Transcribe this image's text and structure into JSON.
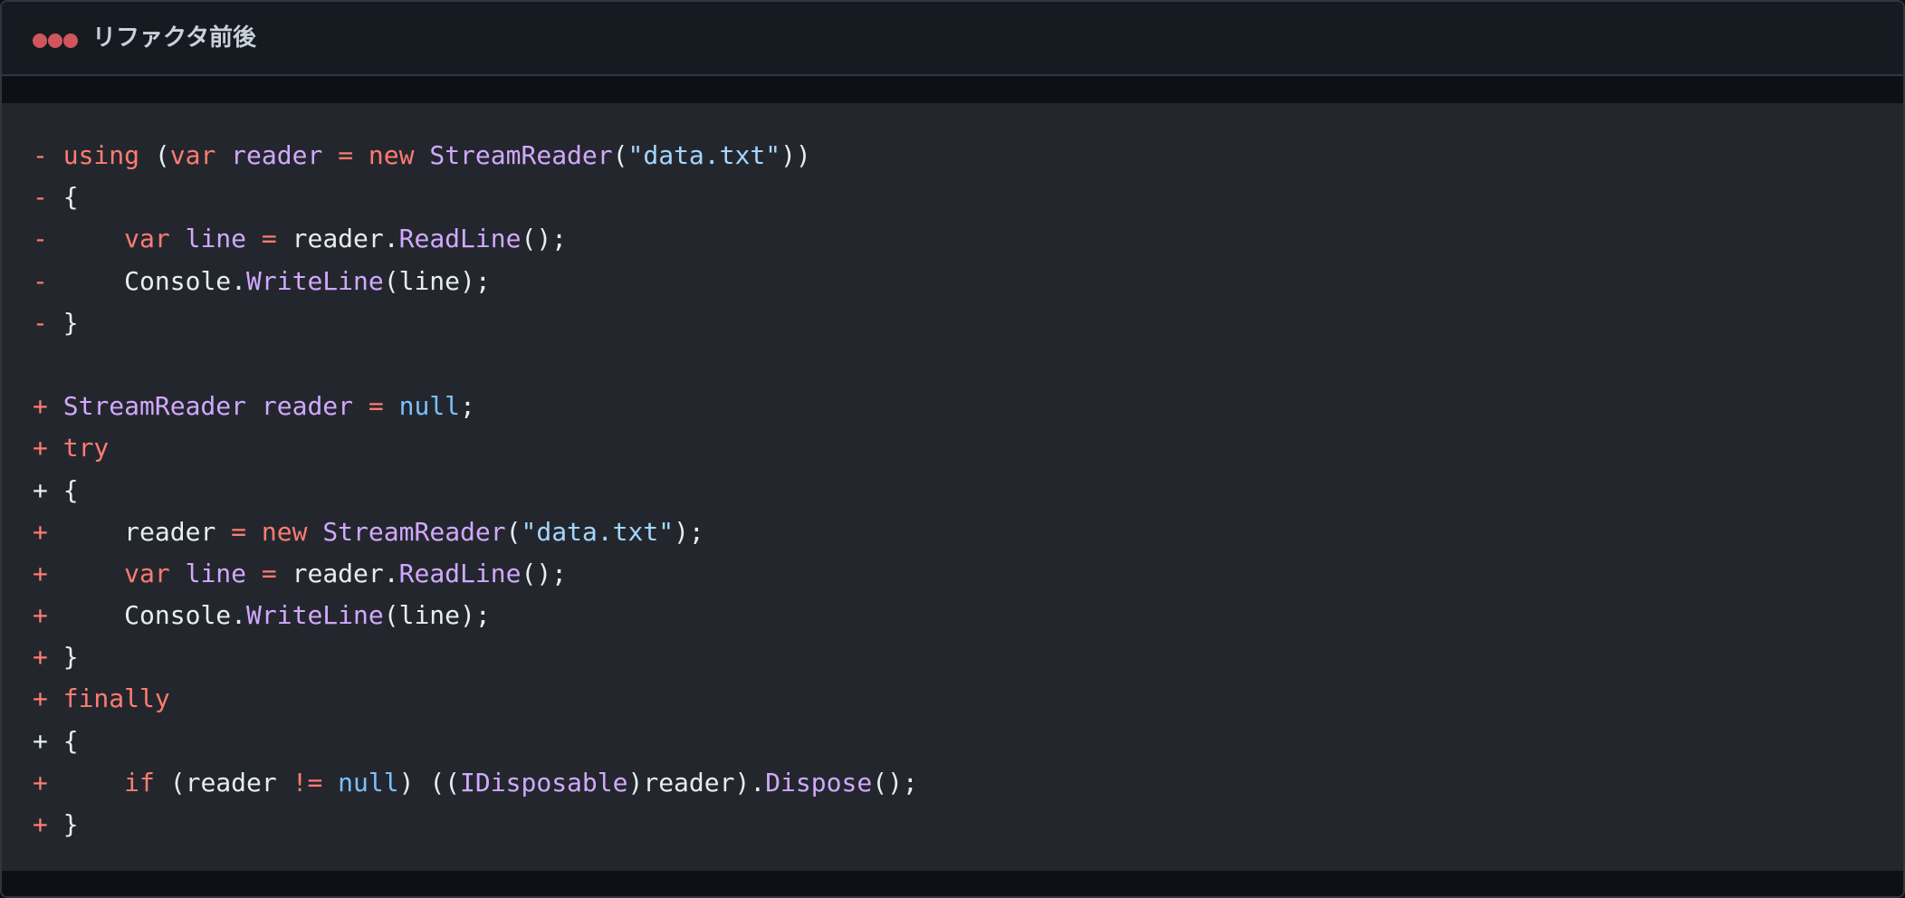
{
  "window": {
    "title": "リファクタ前後"
  },
  "colors": {
    "window_dot": "#d1555d",
    "diff_marker": "#ff7b72",
    "keyword": "#ff7b72",
    "type_identifier": "#d2a8ff",
    "method": "#d2a8ff",
    "string": "#a5d6ff",
    "null_literal": "#79c0ff",
    "plain": "#e6edf3"
  },
  "code_lines": [
    {
      "tokens": [
        {
          "t": "- ",
          "k": "marker"
        },
        {
          "t": "using",
          "k": "keyword"
        },
        {
          "t": " (",
          "k": "plain"
        },
        {
          "t": "var",
          "k": "keyword"
        },
        {
          "t": " ",
          "k": "plain"
        },
        {
          "t": "reader",
          "k": "type"
        },
        {
          "t": " ",
          "k": "plain"
        },
        {
          "t": "=",
          "k": "keyword"
        },
        {
          "t": " ",
          "k": "plain"
        },
        {
          "t": "new",
          "k": "keyword"
        },
        {
          "t": " ",
          "k": "plain"
        },
        {
          "t": "StreamReader",
          "k": "type"
        },
        {
          "t": "(",
          "k": "plain"
        },
        {
          "t": "\"data.txt\"",
          "k": "string"
        },
        {
          "t": "))",
          "k": "plain"
        }
      ]
    },
    {
      "tokens": [
        {
          "t": "- ",
          "k": "marker"
        },
        {
          "t": "{",
          "k": "plain"
        }
      ]
    },
    {
      "tokens": [
        {
          "t": "-     ",
          "k": "marker"
        },
        {
          "t": "var",
          "k": "keyword"
        },
        {
          "t": " ",
          "k": "plain"
        },
        {
          "t": "line",
          "k": "type"
        },
        {
          "t": " ",
          "k": "plain"
        },
        {
          "t": "=",
          "k": "keyword"
        },
        {
          "t": " reader.",
          "k": "plain"
        },
        {
          "t": "ReadLine",
          "k": "method"
        },
        {
          "t": "();",
          "k": "plain"
        }
      ]
    },
    {
      "tokens": [
        {
          "t": "-     ",
          "k": "marker"
        },
        {
          "t": "Console.",
          "k": "plain"
        },
        {
          "t": "WriteLine",
          "k": "method"
        },
        {
          "t": "(line);",
          "k": "plain"
        }
      ]
    },
    {
      "tokens": [
        {
          "t": "- ",
          "k": "marker"
        },
        {
          "t": "}",
          "k": "plain"
        }
      ]
    },
    {
      "tokens": []
    },
    {
      "tokens": [
        {
          "t": "+ ",
          "k": "marker"
        },
        {
          "t": "StreamReader",
          "k": "type"
        },
        {
          "t": " ",
          "k": "plain"
        },
        {
          "t": "reader",
          "k": "type"
        },
        {
          "t": " ",
          "k": "plain"
        },
        {
          "t": "=",
          "k": "keyword"
        },
        {
          "t": " ",
          "k": "plain"
        },
        {
          "t": "null",
          "k": "null"
        },
        {
          "t": ";",
          "k": "plain"
        }
      ]
    },
    {
      "tokens": [
        {
          "t": "+ ",
          "k": "marker"
        },
        {
          "t": "try",
          "k": "keyword"
        }
      ]
    },
    {
      "tokens": [
        {
          "t": "+ {",
          "k": "plain"
        }
      ]
    },
    {
      "tokens": [
        {
          "t": "+     ",
          "k": "marker"
        },
        {
          "t": "reader ",
          "k": "plain"
        },
        {
          "t": "=",
          "k": "keyword"
        },
        {
          "t": " ",
          "k": "plain"
        },
        {
          "t": "new",
          "k": "keyword"
        },
        {
          "t": " ",
          "k": "plain"
        },
        {
          "t": "StreamReader",
          "k": "type"
        },
        {
          "t": "(",
          "k": "plain"
        },
        {
          "t": "\"data.txt\"",
          "k": "string"
        },
        {
          "t": ");",
          "k": "plain"
        }
      ]
    },
    {
      "tokens": [
        {
          "t": "+     ",
          "k": "marker"
        },
        {
          "t": "var",
          "k": "keyword"
        },
        {
          "t": " ",
          "k": "plain"
        },
        {
          "t": "line",
          "k": "type"
        },
        {
          "t": " ",
          "k": "plain"
        },
        {
          "t": "=",
          "k": "keyword"
        },
        {
          "t": " reader.",
          "k": "plain"
        },
        {
          "t": "ReadLine",
          "k": "method"
        },
        {
          "t": "();",
          "k": "plain"
        }
      ]
    },
    {
      "tokens": [
        {
          "t": "+     ",
          "k": "marker"
        },
        {
          "t": "Console.",
          "k": "plain"
        },
        {
          "t": "WriteLine",
          "k": "method"
        },
        {
          "t": "(line);",
          "k": "plain"
        }
      ]
    },
    {
      "tokens": [
        {
          "t": "+ ",
          "k": "marker"
        },
        {
          "t": "}",
          "k": "plain"
        }
      ]
    },
    {
      "tokens": [
        {
          "t": "+ ",
          "k": "marker"
        },
        {
          "t": "finally",
          "k": "keyword"
        }
      ]
    },
    {
      "tokens": [
        {
          "t": "+ {",
          "k": "plain"
        }
      ]
    },
    {
      "tokens": [
        {
          "t": "+     ",
          "k": "marker"
        },
        {
          "t": "if",
          "k": "keyword"
        },
        {
          "t": " (reader ",
          "k": "plain"
        },
        {
          "t": "!=",
          "k": "keyword"
        },
        {
          "t": " ",
          "k": "plain"
        },
        {
          "t": "null",
          "k": "null"
        },
        {
          "t": ") ((",
          "k": "plain"
        },
        {
          "t": "IDisposable",
          "k": "type"
        },
        {
          "t": ")reader).",
          "k": "plain"
        },
        {
          "t": "Dispose",
          "k": "method"
        },
        {
          "t": "();",
          "k": "plain"
        }
      ]
    },
    {
      "tokens": [
        {
          "t": "+ ",
          "k": "marker"
        },
        {
          "t": "}",
          "k": "plain"
        }
      ]
    }
  ]
}
